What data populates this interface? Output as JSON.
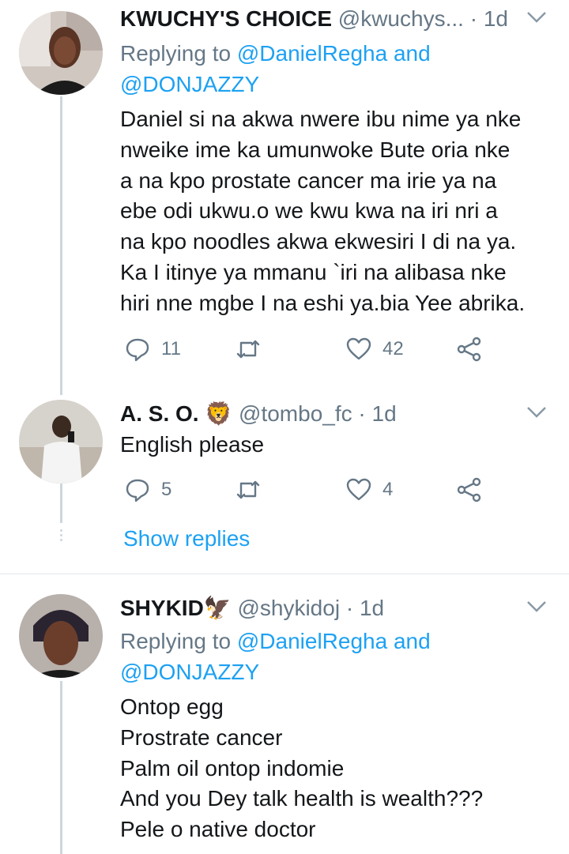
{
  "colors": {
    "accent": "#1da1f2",
    "muted": "#657786",
    "text": "#14171a",
    "line": "#ccd6dd"
  },
  "tweets": [
    {
      "name": "KWUCHY'S CHOICE",
      "handle": "@kwuchys...",
      "sep": "·",
      "time": "1d",
      "replying_prefix": "Replying to ",
      "replying_user1": "@DanielRegha",
      "replying_and": " and",
      "replying_user2": "@DONJAZZY",
      "lines": [
        "Daniel si na akwa nwere ibu nime ya nke",
        "nweike ime ka umunwoke Bute oria nke",
        "a na kpo prostate cancer ma irie ya na",
        "ebe odi ukwu.o we kwu kwa na iri nri a",
        "na kpo noodles akwa ekwesiri I di na ya.",
        "Ka I itinye ya mmanu `iri na alibasa nke",
        "hiri nne mgbe I na eshi ya.bia Yee abrika."
      ],
      "replies": "11",
      "retweets": "",
      "likes": "42"
    },
    {
      "name": "A. S. O.",
      "name_emoji": "🦁",
      "handle": "@tombo_fc",
      "sep": "·",
      "time": "1d",
      "lines": [
        "English please"
      ],
      "replies": "5",
      "retweets": "",
      "likes": "4",
      "show_replies": "Show replies"
    },
    {
      "name": "SHYKID",
      "name_emoji": "🦅",
      "handle": "@shykidoj",
      "sep": "·",
      "time": "1d",
      "replying_prefix": "Replying to ",
      "replying_user1": "@DanielRegha",
      "replying_and": " and",
      "replying_user2": "@DONJAZZY",
      "lines": [
        "Ontop egg",
        "Prostrate cancer",
        "Palm oil ontop indomie",
        "And you Dey talk health is wealth???",
        "Pele o native doctor"
      ]
    }
  ],
  "icons": {
    "reply": "reply-icon",
    "retweet": "retweet-icon",
    "like": "heart-icon",
    "share": "share-icon",
    "more": "chevron-down-icon"
  }
}
